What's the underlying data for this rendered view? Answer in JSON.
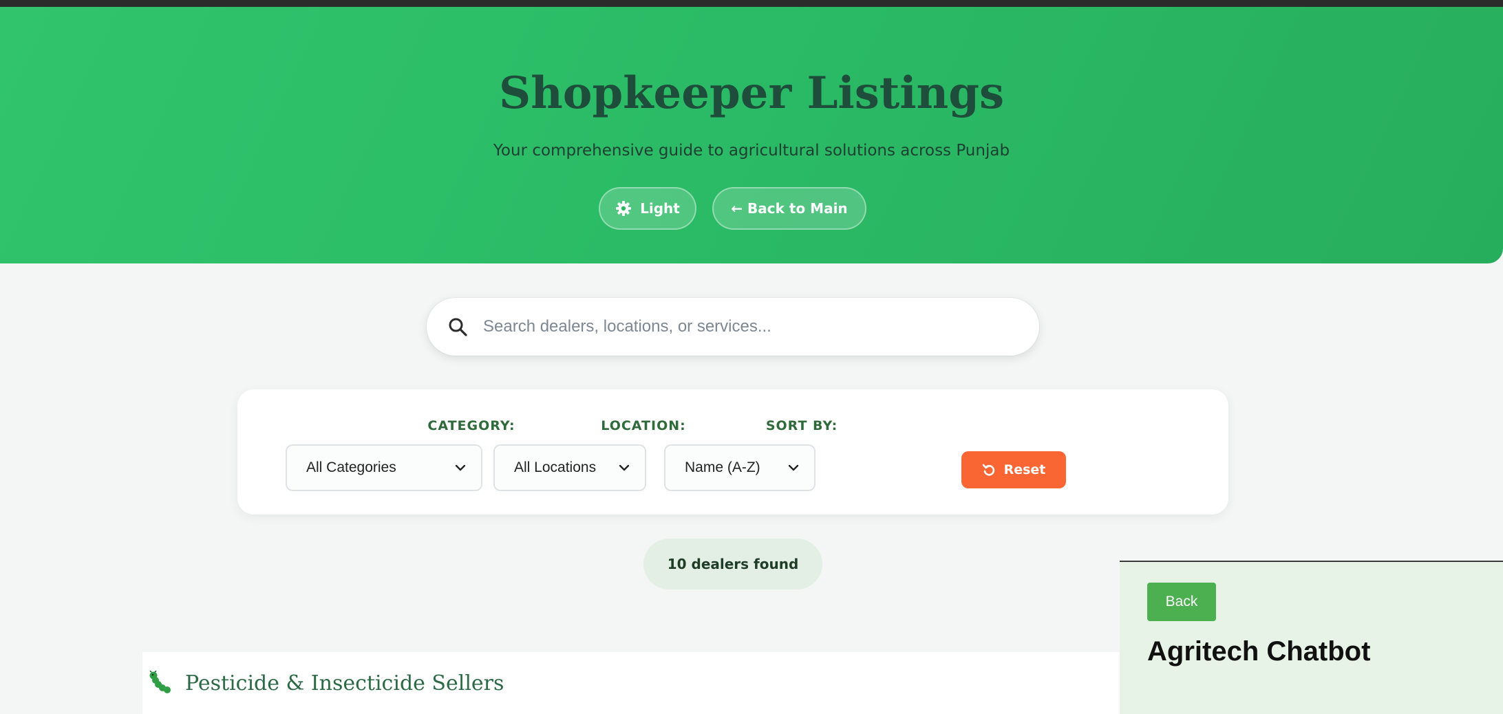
{
  "header": {
    "title": "Shopkeeper Listings",
    "subtitle": "Your comprehensive guide to agricultural solutions across Punjab",
    "theme_button": "Light",
    "back_button": "← Back to Main"
  },
  "search": {
    "placeholder": "Search dealers, locations, or services...",
    "value": ""
  },
  "filters": {
    "category": {
      "label": "CATEGORY:",
      "selected": "All Categories"
    },
    "location": {
      "label": "LOCATION:",
      "selected": "All Locations"
    },
    "sort": {
      "label": "SORT BY:",
      "selected": "Name (A-Z)"
    },
    "reset_label": "Reset"
  },
  "results": {
    "count_text": "10 dealers found"
  },
  "section": {
    "heading": "Pesticide & Insecticide Sellers"
  },
  "chatbot": {
    "back_label": "Back",
    "title": "Agritech Chatbot"
  },
  "colors": {
    "hero_green": "#2bbb66",
    "title_dark_green": "#1e4e3b",
    "reset_orange": "#fa6534",
    "chat_back_green": "#4caf50",
    "chat_panel_bg": "#e6f3e6"
  },
  "icons": {
    "theme": "gear-icon",
    "search": "search-icon",
    "dropdown": "chevron-down-icon",
    "reset": "undo-icon",
    "section": "caterpillar-icon"
  }
}
